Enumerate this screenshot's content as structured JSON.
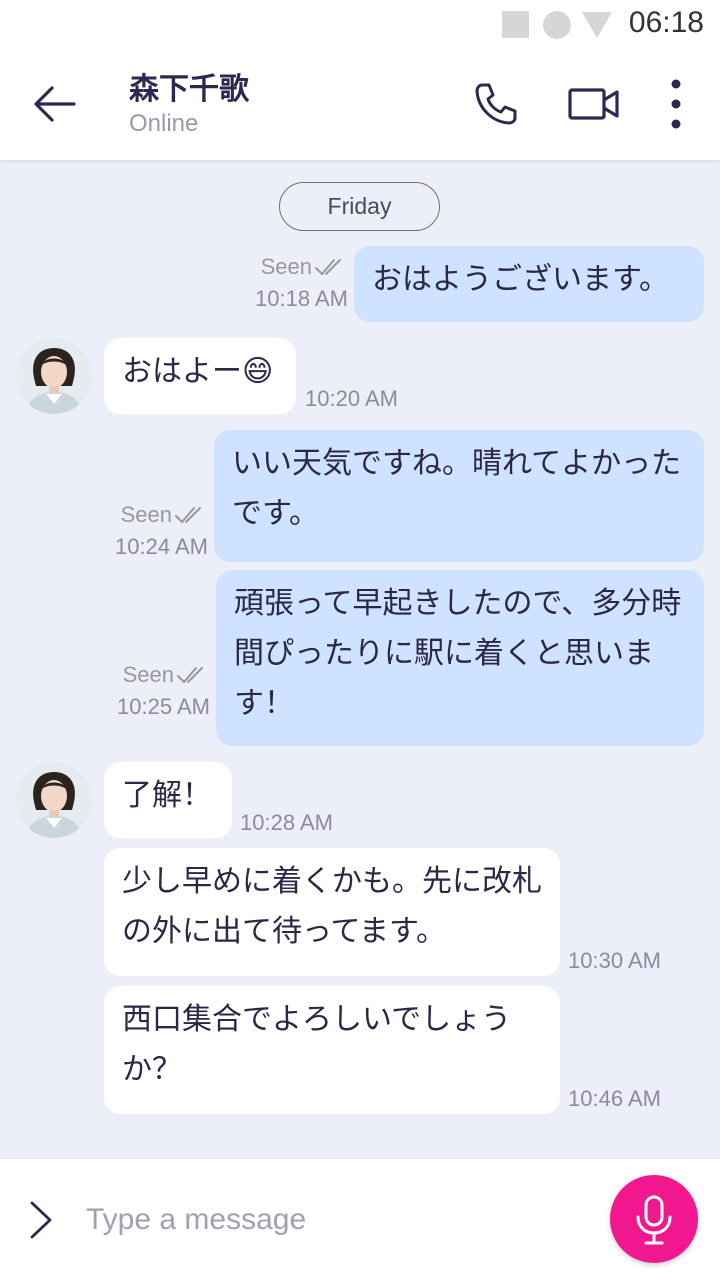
{
  "status_bar": {
    "time": "06:18"
  },
  "header": {
    "contact_name": "森下千歌",
    "status": "Online",
    "back_icon": "arrow-left-icon",
    "call_icon": "phone-icon",
    "video_icon": "video-camera-icon",
    "menu_icon": "more-vertical-icon"
  },
  "chat": {
    "day_label": "Friday",
    "messages": [
      {
        "dir": "out",
        "text": "おはようございます。",
        "seen": "Seen",
        "time": "10:18 AM"
      },
      {
        "dir": "in",
        "text": "おはよー😄",
        "time": "10:20 AM"
      },
      {
        "dir": "out",
        "text": "いい天気ですね。晴れてよかったです。",
        "seen": "Seen",
        "time": "10:24 AM"
      },
      {
        "dir": "out",
        "text": "頑張って早起きしたので、多分時間ぴったりに駅に着くと思います！",
        "seen": "Seen",
        "time": "10:25 AM"
      },
      {
        "dir": "in",
        "text": "了解！",
        "time": "10:28 AM"
      },
      {
        "dir": "in",
        "text": "少し早めに着くかも。先に改札の外に出て待ってます。",
        "time": "10:30 AM"
      },
      {
        "dir": "in",
        "text": "西口集合でよろしいでしょうか？",
        "time": "10:46 AM"
      }
    ]
  },
  "composer": {
    "placeholder": "Type a message",
    "expand_icon": "chevron-right-icon",
    "mic_icon": "microphone-icon"
  },
  "colors": {
    "accent": "#f0178f",
    "outgoing_bubble": "#cfe2ff",
    "incoming_bubble": "#ffffff",
    "chat_background": "#eceef9",
    "header_text": "#2c2850"
  }
}
